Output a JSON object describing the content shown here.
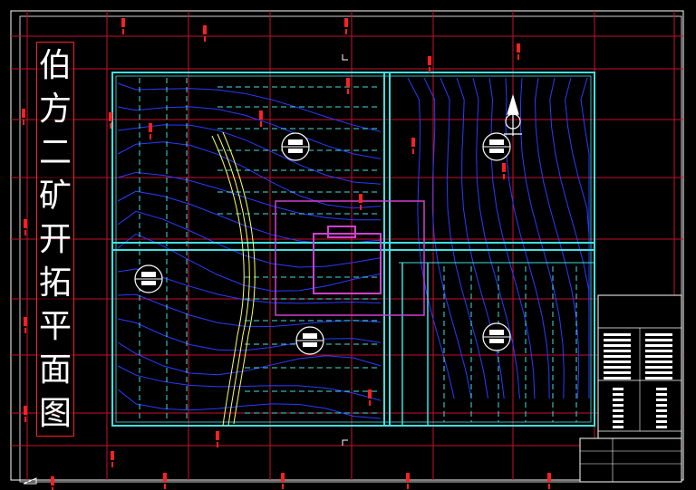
{
  "title": {
    "text": "伯方二矿开拓平面图",
    "chars": [
      "伯",
      "方",
      "二",
      "矿",
      "开",
      "拓",
      "平",
      "面",
      "图"
    ]
  },
  "colors": {
    "background": "#000000",
    "grid": "#c8102e",
    "frame": "#ffffff",
    "boundary": "#40e0e0",
    "contour": "#2a3cff",
    "roadway": "#40e0e0",
    "fault": "#ffff66",
    "pit": "#d040d0",
    "marker": "#ff2020",
    "title_text": "#ffffff"
  },
  "drawing": {
    "compass_icon": "north-arrow-icon",
    "legend_panel": "title-block-legend-table"
  }
}
